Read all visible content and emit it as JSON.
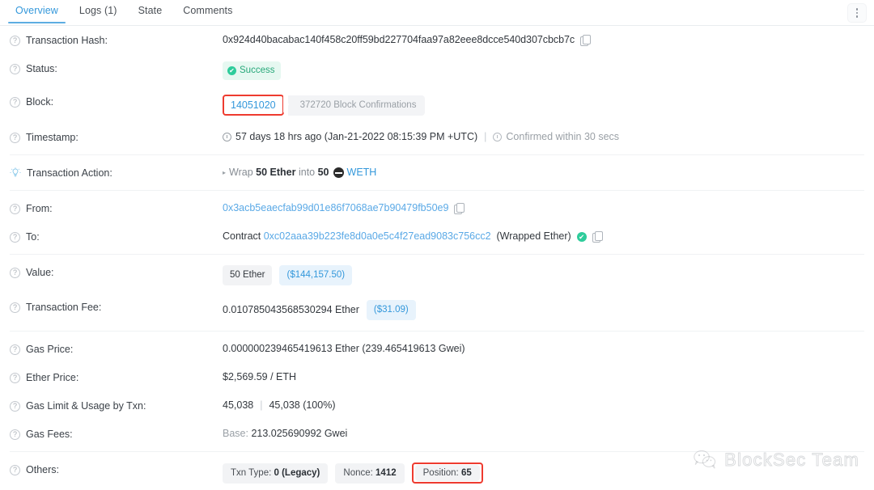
{
  "tabs": [
    {
      "label": "Overview",
      "name": "tab-overview",
      "active": true
    },
    {
      "label": "Logs (1)",
      "name": "tab-logs",
      "active": false
    },
    {
      "label": "State",
      "name": "tab-state",
      "active": false
    },
    {
      "label": "Comments",
      "name": "tab-comments",
      "active": false
    }
  ],
  "menu": {
    "icon": "kebab-menu-icon"
  },
  "rows": {
    "transaction_hash": {
      "label": "Transaction Hash:",
      "value": "0x924d40bacabac140f458c20ff59bd227704faa97a82eee8dcce540d307cbcb7c"
    },
    "status": {
      "label": "Status:",
      "badge": "Success",
      "check": "✔"
    },
    "block": {
      "label": "Block:",
      "number": "14051020",
      "confirmations": "372720 Block Confirmations",
      "annotated": true
    },
    "timestamp": {
      "label": "Timestamp:",
      "ago": "57 days 18 hrs ago (Jan-21-2022 08:15:39 PM +UTC)",
      "separator": "|",
      "confirmed": "Confirmed within 30 secs"
    },
    "transaction_action": {
      "label": "Transaction Action:",
      "caret": "▸",
      "verb": "Wrap",
      "amount_in": "50 Ether",
      "into": "into",
      "amount_out": "50",
      "token": "WETH",
      "token_icon": "eth-token-icon"
    },
    "from": {
      "label": "From:",
      "address": "0x3acb5eaecfab99d01e86f7068ae7b90479fb50e9"
    },
    "to": {
      "label": "To:",
      "prefix": "Contract",
      "address": "0xc02aaa39b223fe8d0a0e5c4f27ead9083c756cc2",
      "name": "(Wrapped Ether)",
      "verified": "✔"
    },
    "value": {
      "label": "Value:",
      "amount": "50 Ether",
      "fiat": "($144,157.50)"
    },
    "transaction_fee": {
      "label": "Transaction Fee:",
      "amount": "0.010785043568530294 Ether",
      "fiat": "($31.09)"
    },
    "gas_price": {
      "label": "Gas Price:",
      "value": "0.000000239465419613 Ether (239.465419613 Gwei)"
    },
    "ether_price": {
      "label": "Ether Price:",
      "value": "$2,569.59 / ETH"
    },
    "gas_limit": {
      "label": "Gas Limit & Usage by Txn:",
      "limit": "45,038",
      "separator": "|",
      "usage": "45,038 (100%)"
    },
    "gas_fees": {
      "label": "Gas Fees:",
      "base_label": "Base:",
      "base_value": "213.025690992 Gwei"
    },
    "others": {
      "label": "Others:",
      "txn_type_label": "Txn Type:",
      "txn_type_value": "0 (Legacy)",
      "nonce_label": "Nonce:",
      "nonce_value": "1412",
      "position_label": "Position:",
      "position_value": "65",
      "position_annotated": true
    }
  },
  "watermark": {
    "text": "BlockSec Team",
    "icon": "wechat-icon"
  },
  "colors": {
    "accent": "#3498db",
    "success": "#2ecc9b",
    "annotation": "#ee3b2f",
    "muted": "#9aa0a6"
  }
}
